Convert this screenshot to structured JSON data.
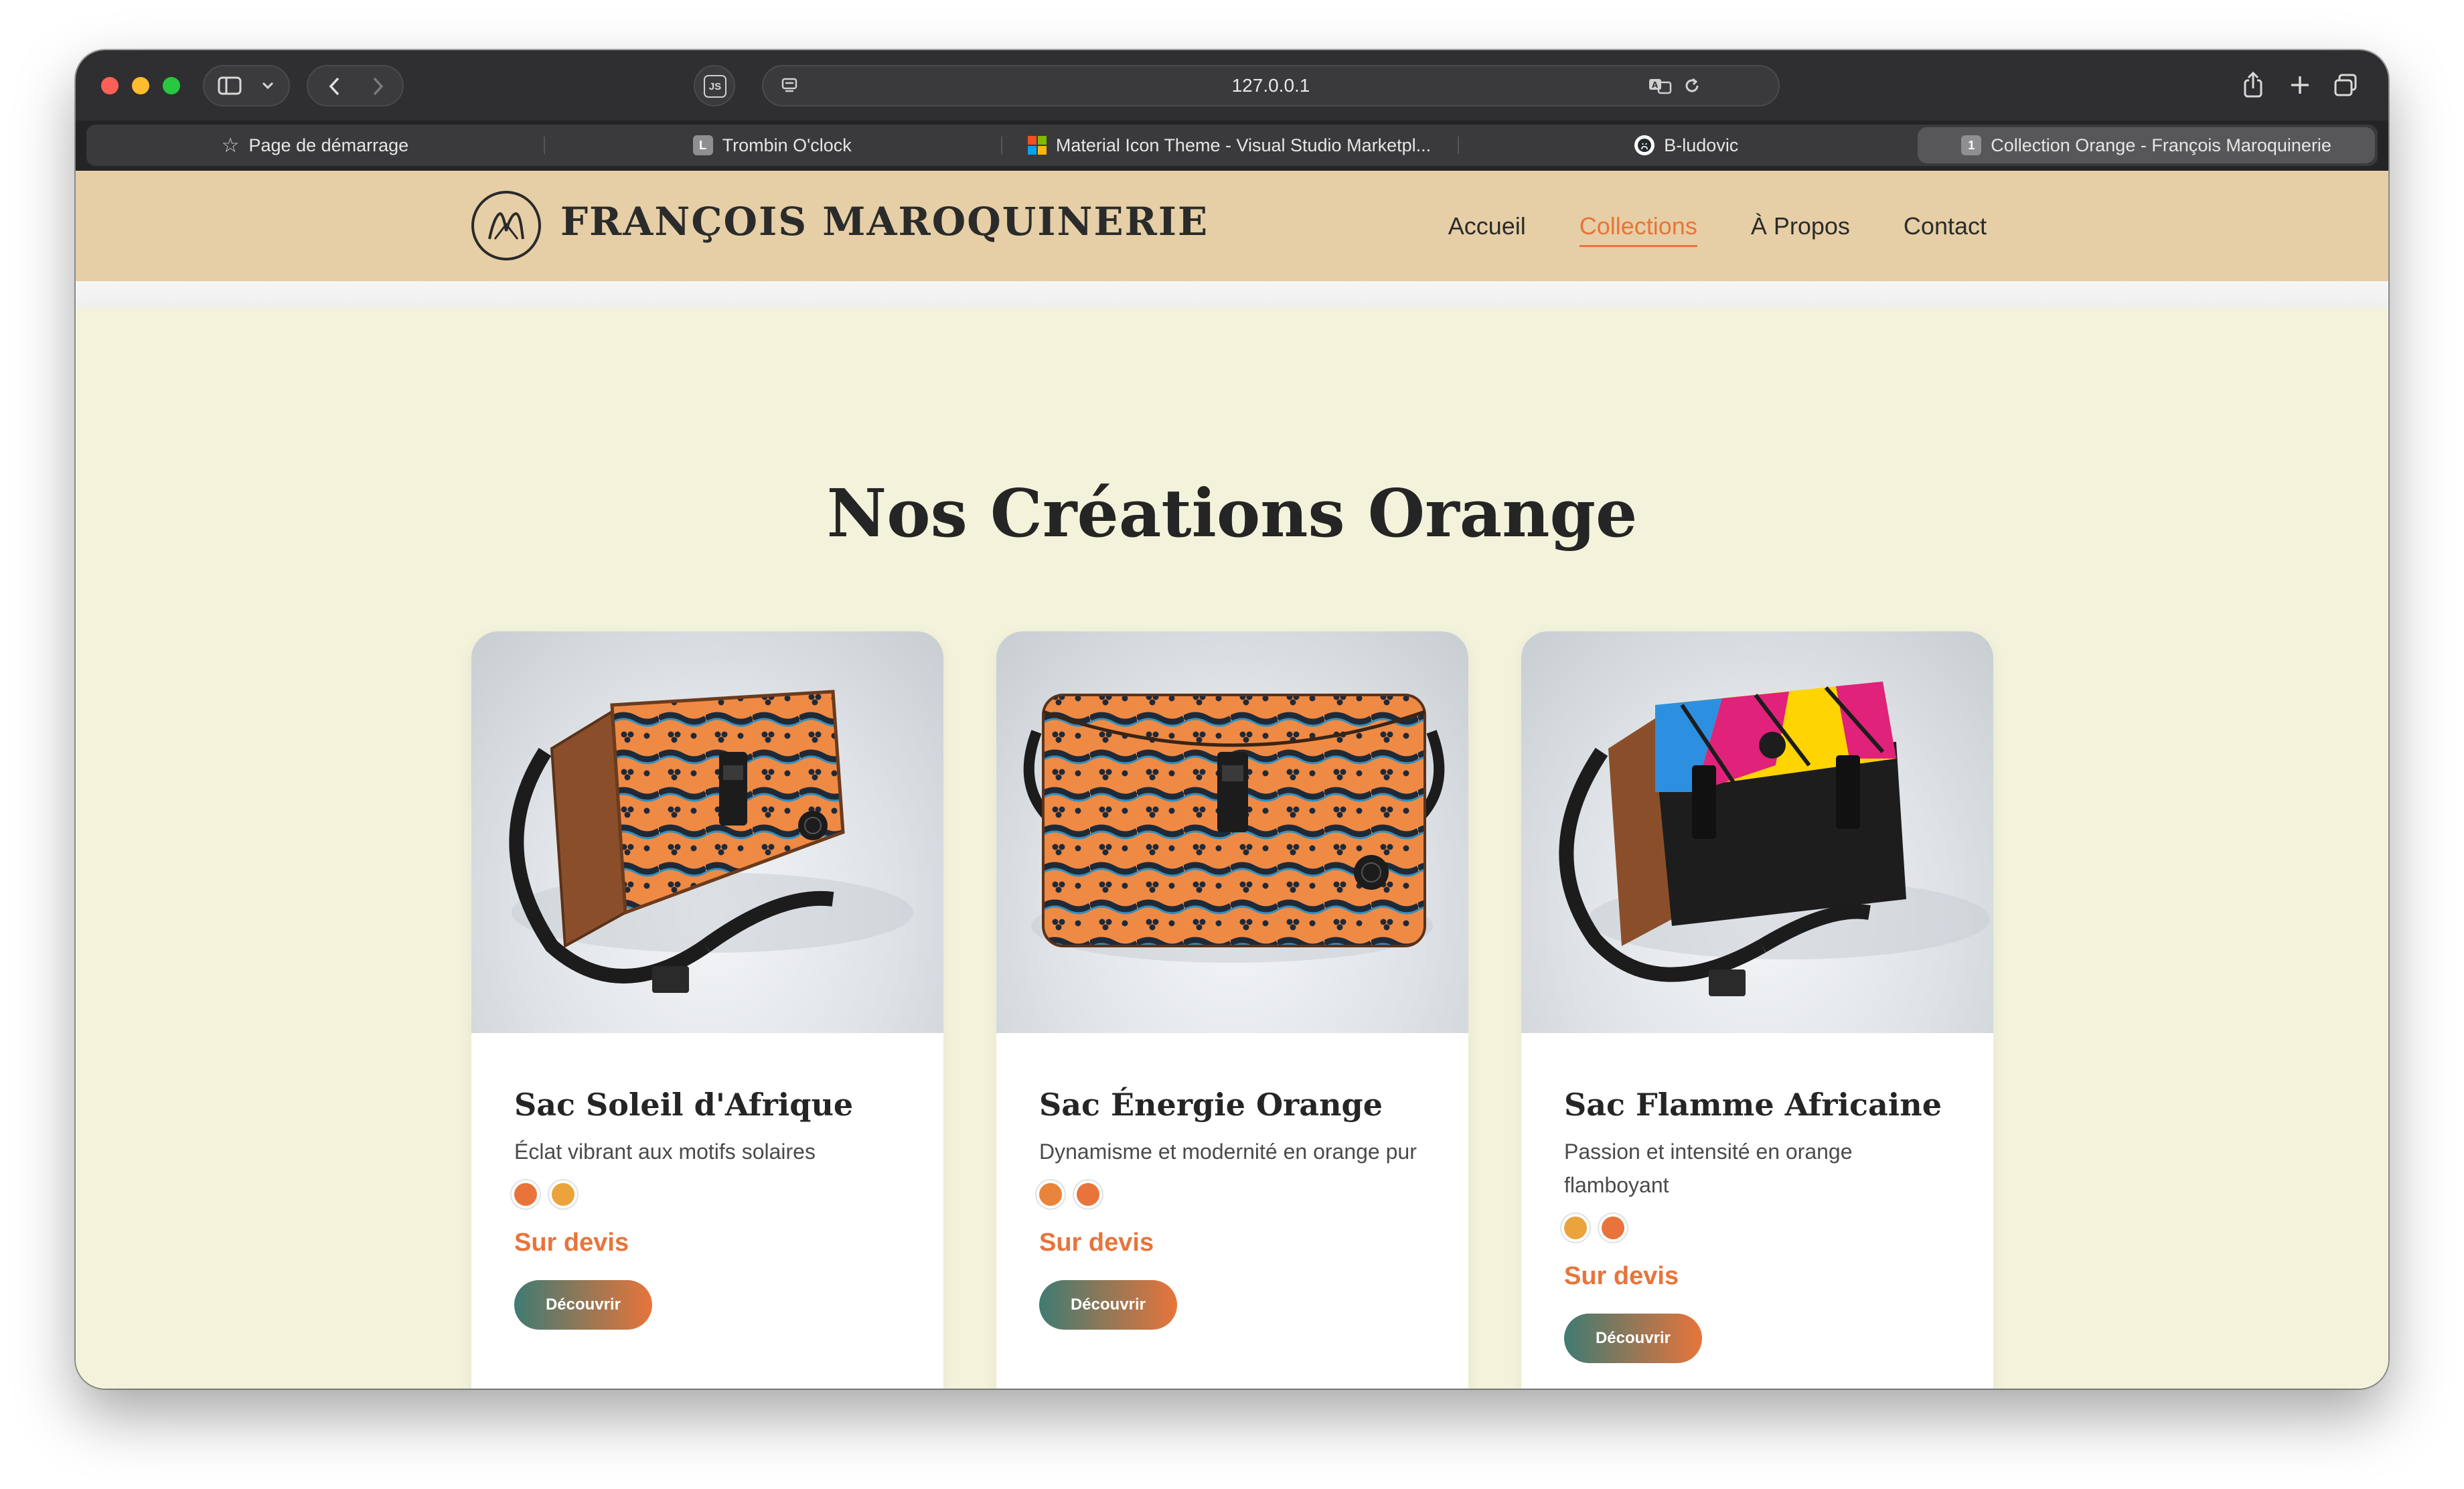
{
  "browser": {
    "url": "127.0.0.1",
    "tabs": [
      {
        "label": "Page de démarrage",
        "icon": "star-icon",
        "active": false
      },
      {
        "label": "Trombin O'clock",
        "icon": "L",
        "active": false
      },
      {
        "label": "Material Icon Theme - Visual Studio Marketpl...",
        "icon": "microsoft-icon",
        "active": false
      },
      {
        "label": "B-ludovic",
        "icon": "github-icon",
        "active": false
      },
      {
        "label": "Collection Orange - François Maroquinerie",
        "icon": "1",
        "active": true
      }
    ]
  },
  "site": {
    "brand": "FRANÇOIS MAROQUINERIE",
    "nav": [
      {
        "label": "Accueil",
        "active": false
      },
      {
        "label": "Collections",
        "active": true
      },
      {
        "label": "À Propos",
        "active": false
      },
      {
        "label": "Contact",
        "active": false
      }
    ]
  },
  "main": {
    "title": "Nos Créations Orange",
    "cards": [
      {
        "title": "Sac Soleil d'Afrique",
        "description": "Éclat vibrant aux motifs solaires",
        "swatches": [
          "#e8743b",
          "#eaa43b"
        ],
        "price": "Sur devis",
        "button": "Découvrir"
      },
      {
        "title": "Sac Énergie Orange",
        "description": "Dynamisme et modernité en orange pur",
        "swatches": [
          "#e8843b",
          "#e8743b"
        ],
        "price": "Sur devis",
        "button": "Découvrir"
      },
      {
        "title": "Sac Flamme Africaine",
        "description": "Passion et intensité en orange flamboyant",
        "swatches": [
          "#eaa43b",
          "#e8743b"
        ],
        "price": "Sur devis",
        "button": "Découvrir"
      }
    ]
  },
  "colors": {
    "accent": "#e8743b",
    "header_bg": "#e6cfa6",
    "page_bg": "#f3f3dc",
    "button_gradient_start": "#3f7b73"
  }
}
